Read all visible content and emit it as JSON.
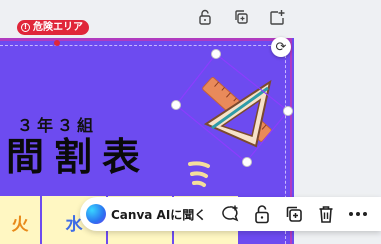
{
  "canvas": {
    "background_color": "#6d4bf0",
    "class_label": "３年３組",
    "title": "間割表",
    "danger_badge": {
      "label": "危険エリア",
      "icon": "warning-circle-icon",
      "color": "#e0263a"
    }
  },
  "page_tools": {
    "icons": [
      "lock-icon",
      "duplicate-page-icon",
      "add-page-icon"
    ]
  },
  "timetable": {
    "days": [
      {
        "label": "火",
        "color": "#e88a1a"
      },
      {
        "label": "水",
        "color": "#3f6de6"
      },
      {
        "label": "",
        "color": "#1b1b1b"
      },
      {
        "label": "",
        "color": "#1b1b1b"
      }
    ],
    "cell_color": "#fff7c2"
  },
  "context_toolbar": {
    "ai_button_label": "Canva AIに聞く",
    "icons": [
      "comment-add-icon",
      "lock-icon",
      "duplicate-icon",
      "trash-icon",
      "more-icon"
    ]
  },
  "selection": {
    "rotate_icon": "rotate-icon",
    "accent_color": "#8b3dff"
  }
}
